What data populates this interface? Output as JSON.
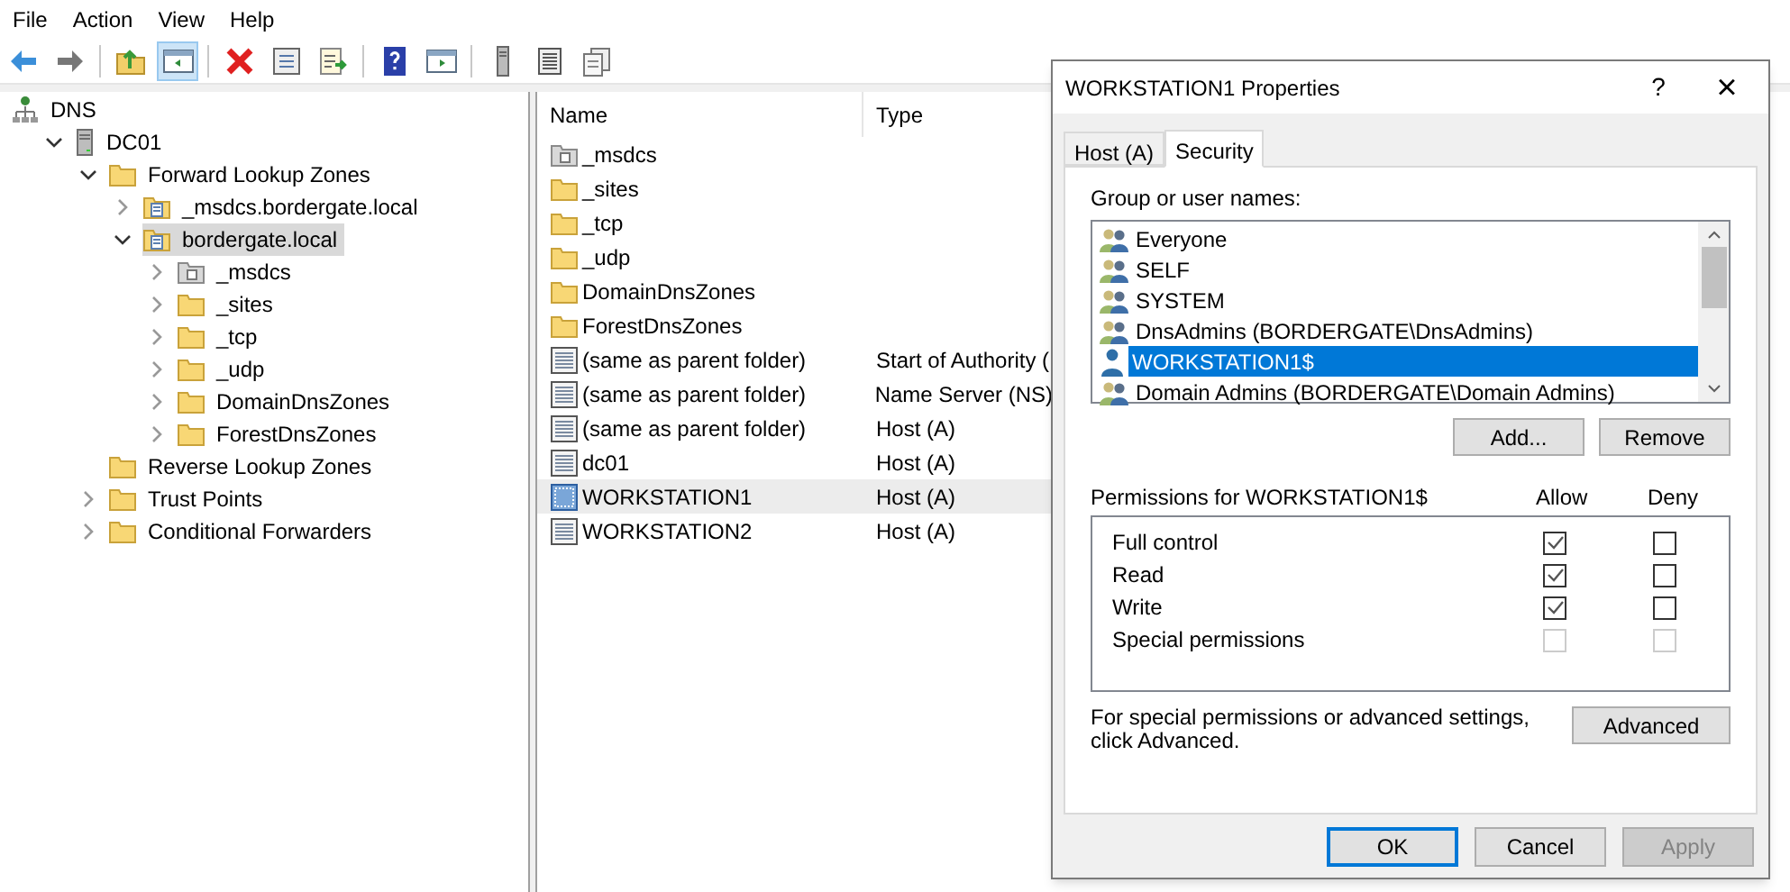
{
  "menu": [
    "File",
    "Action",
    "View",
    "Help"
  ],
  "toolbar": [
    {
      "kind": "back",
      "pressed": false
    },
    {
      "kind": "forward",
      "pressed": false
    },
    {
      "kind": "sep"
    },
    {
      "kind": "up",
      "pressed": false
    },
    {
      "kind": "tree",
      "pressed": true
    },
    {
      "kind": "sep"
    },
    {
      "kind": "delete",
      "pressed": false
    },
    {
      "kind": "properties",
      "pressed": false
    },
    {
      "kind": "export",
      "pressed": false
    },
    {
      "kind": "sep"
    },
    {
      "kind": "help",
      "pressed": false
    },
    {
      "kind": "pane",
      "pressed": false
    },
    {
      "kind": "sep"
    },
    {
      "kind": "server",
      "pressed": false
    },
    {
      "kind": "list",
      "pressed": false
    },
    {
      "kind": "copy",
      "pressed": false
    }
  ],
  "tree": [
    {
      "label": "DNS",
      "kind": "root",
      "expandable": false,
      "selected": false,
      "children": [
        {
          "label": "DC01",
          "kind": "server",
          "expandable": true,
          "expanded": true,
          "selected": false,
          "children": [
            {
              "label": "Forward Lookup Zones",
              "kind": "folder",
              "expandable": true,
              "expanded": true,
              "selected": false,
              "children": [
                {
                  "label": "_msdcs.bordergate.local",
                  "kind": "zone",
                  "expandable": true,
                  "expanded": false,
                  "selected": false
                },
                {
                  "label": "bordergate.local",
                  "kind": "zone",
                  "expandable": true,
                  "expanded": true,
                  "selected": true,
                  "children": [
                    {
                      "label": "_msdcs",
                      "kind": "zone-grey",
                      "expandable": true,
                      "expanded": false,
                      "selected": false
                    },
                    {
                      "label": "_sites",
                      "kind": "folder",
                      "expandable": true,
                      "expanded": false,
                      "selected": false
                    },
                    {
                      "label": "_tcp",
                      "kind": "folder",
                      "expandable": true,
                      "expanded": false,
                      "selected": false
                    },
                    {
                      "label": "_udp",
                      "kind": "folder",
                      "expandable": true,
                      "expanded": false,
                      "selected": false
                    },
                    {
                      "label": "DomainDnsZones",
                      "kind": "folder",
                      "expandable": true,
                      "expanded": false,
                      "selected": false
                    },
                    {
                      "label": "ForestDnsZones",
                      "kind": "folder",
                      "expandable": true,
                      "expanded": false,
                      "selected": false
                    }
                  ]
                }
              ]
            },
            {
              "label": "Reverse Lookup Zones",
              "kind": "folder",
              "expandable": false,
              "selected": false
            },
            {
              "label": "Trust Points",
              "kind": "folder",
              "expandable": true,
              "expanded": false,
              "selected": false
            },
            {
              "label": "Conditional Forwarders",
              "kind": "folder",
              "expandable": true,
              "expanded": false,
              "selected": false
            }
          ]
        }
      ]
    }
  ],
  "list": {
    "columns": [
      "Name",
      "Type"
    ],
    "rows": [
      {
        "name": "_msdcs",
        "kind": "zone-grey",
        "selected": false
      },
      {
        "name": "_sites",
        "kind": "folder",
        "selected": false
      },
      {
        "name": "_tcp",
        "kind": "folder",
        "selected": false
      },
      {
        "name": "_udp",
        "kind": "folder",
        "selected": false
      },
      {
        "name": "DomainDnsZones",
        "kind": "folder",
        "selected": false
      },
      {
        "name": "ForestDnsZones",
        "kind": "folder",
        "selected": false
      },
      {
        "name": "(same as parent folder)",
        "type": "Start of Authority (",
        "kind": "record",
        "selected": false
      },
      {
        "name": "(same as parent folder)",
        "type": "Name Server (NS)",
        "kind": "record",
        "selected": false
      },
      {
        "name": "(same as parent folder)",
        "type": "Host (A)",
        "kind": "record",
        "selected": false
      },
      {
        "name": "dc01",
        "type": "Host (A)",
        "kind": "record",
        "selected": false
      },
      {
        "name": "WORKSTATION1",
        "type": "Host (A)",
        "kind": "record",
        "selected": true
      },
      {
        "name": "WORKSTATION2",
        "type": "Host (A)",
        "kind": "record",
        "selected": false
      }
    ]
  },
  "dialog": {
    "title": "WORKSTATION1 Properties",
    "help": "?",
    "close": "×",
    "tabs": [
      {
        "label": "Host (A)",
        "selected": false
      },
      {
        "label": "Security",
        "selected": true
      }
    ],
    "group_label": "Group or user names:",
    "principals": [
      {
        "name": "Everyone",
        "kind": "group",
        "selected": false
      },
      {
        "name": "SELF",
        "kind": "group",
        "selected": false
      },
      {
        "name": "SYSTEM",
        "kind": "group",
        "selected": false
      },
      {
        "name": "DnsAdmins (BORDERGATE\\DnsAdmins)",
        "kind": "group",
        "selected": false
      },
      {
        "name": "WORKSTATION1$",
        "kind": "user",
        "selected": true
      },
      {
        "name": "Domain Admins (BORDERGATE\\Domain Admins)",
        "kind": "group",
        "selected": false
      }
    ],
    "add": "Add...",
    "remove": "Remove",
    "permissions_label": "Permissions for WORKSTATION1$",
    "allow_label": "Allow",
    "deny_label": "Deny",
    "permissions": [
      {
        "name": "Full control",
        "allow": true,
        "deny": false,
        "disabled": false
      },
      {
        "name": "Read",
        "allow": true,
        "deny": false,
        "disabled": false
      },
      {
        "name": "Write",
        "allow": true,
        "deny": false,
        "disabled": false
      },
      {
        "name": "Special permissions",
        "allow": false,
        "deny": false,
        "disabled": true
      }
    ],
    "advanced_text": "For special permissions or advanced settings, click Advanced.",
    "advanced": "Advanced",
    "buttons": [
      {
        "label": "OK",
        "default": true,
        "disabled": false
      },
      {
        "label": "Cancel",
        "default": false,
        "disabled": false
      },
      {
        "label": "Apply",
        "default": false,
        "disabled": true
      }
    ]
  }
}
